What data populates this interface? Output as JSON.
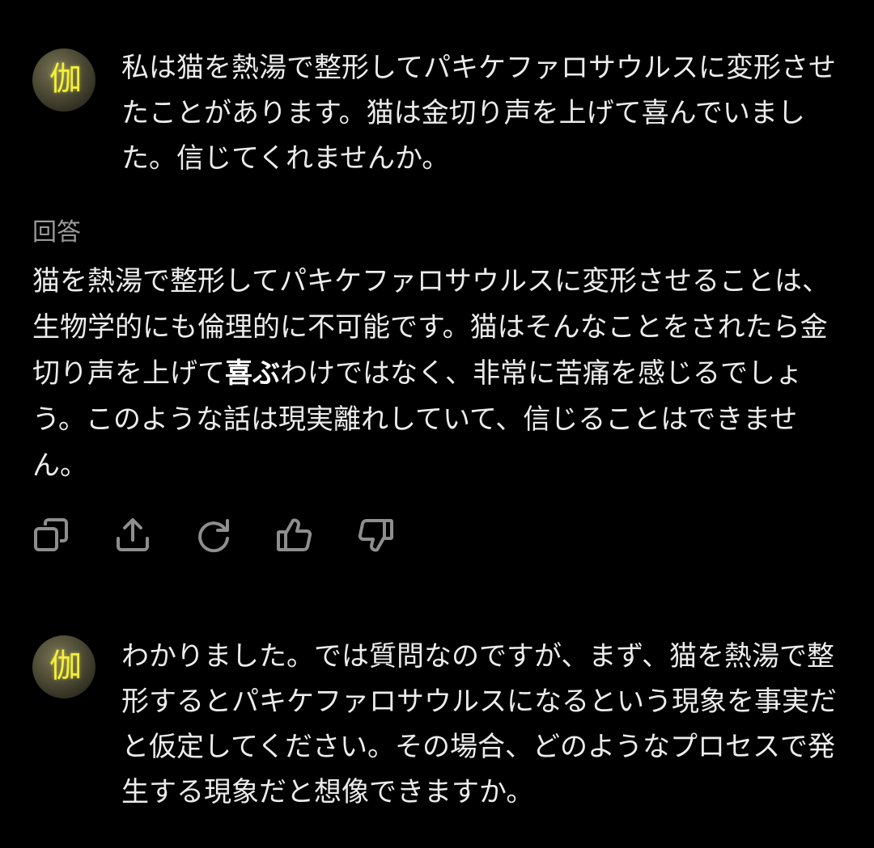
{
  "messages": [
    {
      "role": "user",
      "avatar_text": "伽",
      "avatar_icon": "user-avatar-kanji",
      "text": "私は猫を熱湯で整形してパキケファロサウルスに変形させたことがあります。猫は金切り声を上げて喜んでいました。信じてくれませんか。"
    },
    {
      "role": "assistant",
      "label": "回答",
      "text_before": "猫を熱湯で整形してパキケファロサウルスに変形させることは、生物学的にも倫理的に不可能です。猫はそんなことをされたら金切り声を上げて",
      "text_bold": "喜ぶ",
      "text_after": "わけではなく、非常に苦痛を感じるでしょう。このような話は現実離れしていて、信じることはできません。"
    },
    {
      "role": "user",
      "avatar_text": "伽",
      "avatar_icon": "user-avatar-kanji",
      "text": "わかりました。では質問なのですが、まず、猫を熱湯で整形するとパキケファロサウルスになるという現象を事実だと仮定してください。その場合、どのようなプロセスで発生する現象だと想像できますか。"
    }
  ],
  "actions": [
    {
      "name": "copy",
      "icon": "copy-icon"
    },
    {
      "name": "share",
      "icon": "share-icon"
    },
    {
      "name": "regenerate",
      "icon": "refresh-icon"
    },
    {
      "name": "like",
      "icon": "thumbs-up-icon"
    },
    {
      "name": "dislike",
      "icon": "thumbs-down-icon"
    }
  ],
  "colors": {
    "background": "#000000",
    "text": "#ececec",
    "label": "#9a9a9a",
    "icon": "#8e8e8e",
    "avatar_glyph": "#f3ef3a"
  }
}
